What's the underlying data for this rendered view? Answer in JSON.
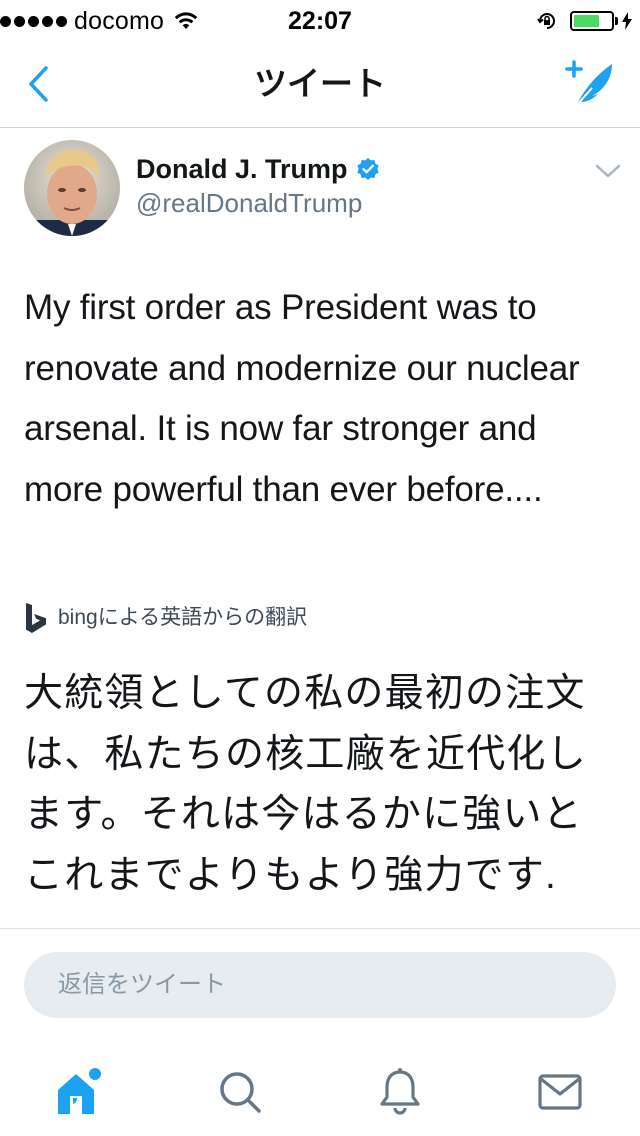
{
  "status_bar": {
    "carrier": "docomo",
    "time": "22:07",
    "signal_icon": "signal-dots-icon",
    "wifi_icon": "wifi-icon",
    "rotation_lock_icon": "rotation-lock-icon",
    "battery_level": 0.7,
    "battery_color": "#4cd964",
    "charging_icon": "charging-bolt-icon"
  },
  "nav": {
    "back_icon": "chevron-left-icon",
    "title": "ツイート",
    "compose_icon": "compose-tweet-icon",
    "accent_color": "#1da1f2"
  },
  "tweet": {
    "author_name": "Donald J. Trump",
    "author_handle": "@realDonaldTrump",
    "verified_icon": "verified-badge-icon",
    "menu_icon": "chevron-down-icon",
    "text": "My first order as President was to renovate and modernize our nuclear arsenal. It is now far stronger and more powerful than ever before....",
    "translation_attribution": "bingによる英語からの翻訳",
    "translation_icon": "bing-logo-icon",
    "translated_text": "大統領としての私の最初の注文は、私たちの核工廠を近代化します。それは今はるかに強いとこれまでよりもより強力です."
  },
  "reply": {
    "placeholder": "返信をツイート"
  },
  "tab_bar": {
    "tabs": [
      {
        "name": "home",
        "icon": "home-icon",
        "active": true
      },
      {
        "name": "search",
        "icon": "search-icon",
        "active": false
      },
      {
        "name": "notifications",
        "icon": "bell-icon",
        "active": false
      },
      {
        "name": "messages",
        "icon": "envelope-icon",
        "active": false
      }
    ]
  },
  "colors": {
    "accent": "#1da1f2",
    "text_primary": "#14171a",
    "text_secondary": "#657786",
    "icon_gray": "#657786"
  }
}
